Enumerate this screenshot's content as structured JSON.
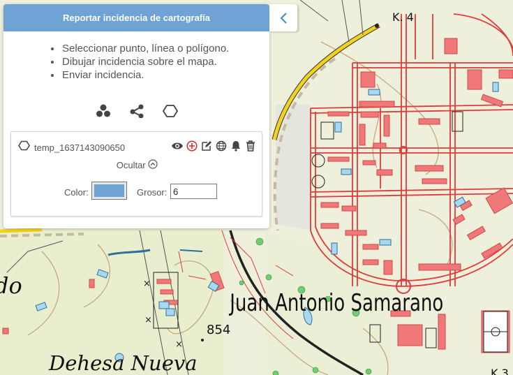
{
  "panel": {
    "title": "Reportar incidencia de cartografía",
    "collapse_icon": "chevron-left-icon",
    "instructions": [
      "Seleccionar punto, línea o polígono.",
      "Dibujar incidencia sobre el mapa.",
      "Enviar incidencia."
    ],
    "tools": [
      "point-tool-icon",
      "line-tool-icon",
      "polygon-tool-icon"
    ],
    "layer": {
      "name": "temp_1637143090650",
      "actions": [
        "eye-icon",
        "add-circle-icon",
        "edit-icon",
        "globe-icon",
        "bell-icon",
        "trash-icon"
      ],
      "hide_label": "Ocultar",
      "color_label": "Color:",
      "color_value": "#6fa3d3",
      "grosor_label": "Grosor:",
      "grosor_value": "6"
    }
  },
  "map": {
    "labels": {
      "place_samaranch": "Juan Antonio Samarano",
      "place_dehesa": "Dehesa Nueva",
      "elevation": "854",
      "road_k4": "K. 4",
      "partial_left": "do",
      "partial_bottom": "K 3"
    },
    "colors": {
      "background": "#eef0dc",
      "road_yellow": "#f2d21a",
      "building_red": "#f07878",
      "outline_red": "#e03a3a",
      "water_blue": "#a8d8ef",
      "contour_brown": "#c8a87c",
      "railway": "#222222"
    }
  }
}
